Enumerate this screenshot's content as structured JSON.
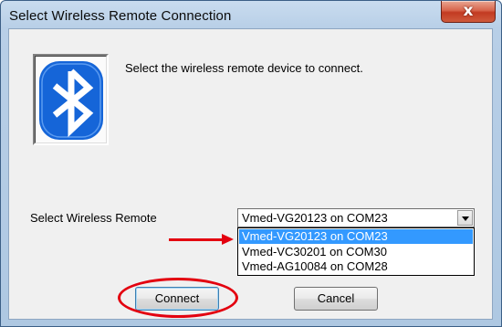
{
  "window": {
    "title": "Select Wireless Remote Connection",
    "close_glyph": "x"
  },
  "dialog": {
    "icon": "bluetooth-icon",
    "prompt": "Select the wireless remote device to connect.",
    "field_label": "Select Wireless Remote",
    "selected_value": "Vmed-VG20123 on COM23",
    "options": [
      "Vmed-VG20123 on COM23",
      "Vmed-VC30201 on COM30",
      "Vmed-AG10084 on COM28"
    ],
    "highlighted_option": "Vmed-VG20123 on COM23"
  },
  "buttons": {
    "connect": "Connect",
    "cancel": "Cancel"
  },
  "annotations": {
    "arrow_color": "#e3000f",
    "ellipse_color": "#e3000f"
  },
  "colors": {
    "bluetooth_blue": "#1565d8",
    "selection_blue": "#3399ff"
  }
}
